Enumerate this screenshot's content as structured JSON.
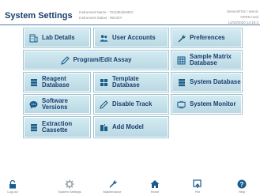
{
  "header": {
    "title": "System Settings",
    "instrument_name": "Instrument Name : 7S/1084/8HEO",
    "instrument_status": "Instrument Status : READY",
    "top_right_line1": "ServiceFSS / Servic",
    "top_right_line2": "OPEN mod",
    "top_right_line3": "11/03/2020 14:16:3"
  },
  "buttons": {
    "lab_details": "Lab Details",
    "user_accounts": "User Accounts",
    "preferences": "Preferences",
    "program_edit_assay": "Program/Edit Assay",
    "sample_matrix_database": "Sample Matrix\nDatabase",
    "reagent_database": "Reagent\nDatabase",
    "template_database": "Template\nDatabase",
    "system_database": "System Database",
    "software_versions": "Software\nVersions",
    "disable_track": "Disable Track",
    "system_monitor": "System Monitor",
    "extraction_cassette": "Extraction\nCassette",
    "add_model": "Add Model"
  },
  "bottom_bar": {
    "logout": "Log out",
    "system_settings": "System Settings",
    "maintenance": "Maintenance",
    "home": "Home",
    "file": "File",
    "help": "Help"
  },
  "colors": {
    "accent": "#1a3e6e",
    "button_fill": "#c6e2ec"
  }
}
